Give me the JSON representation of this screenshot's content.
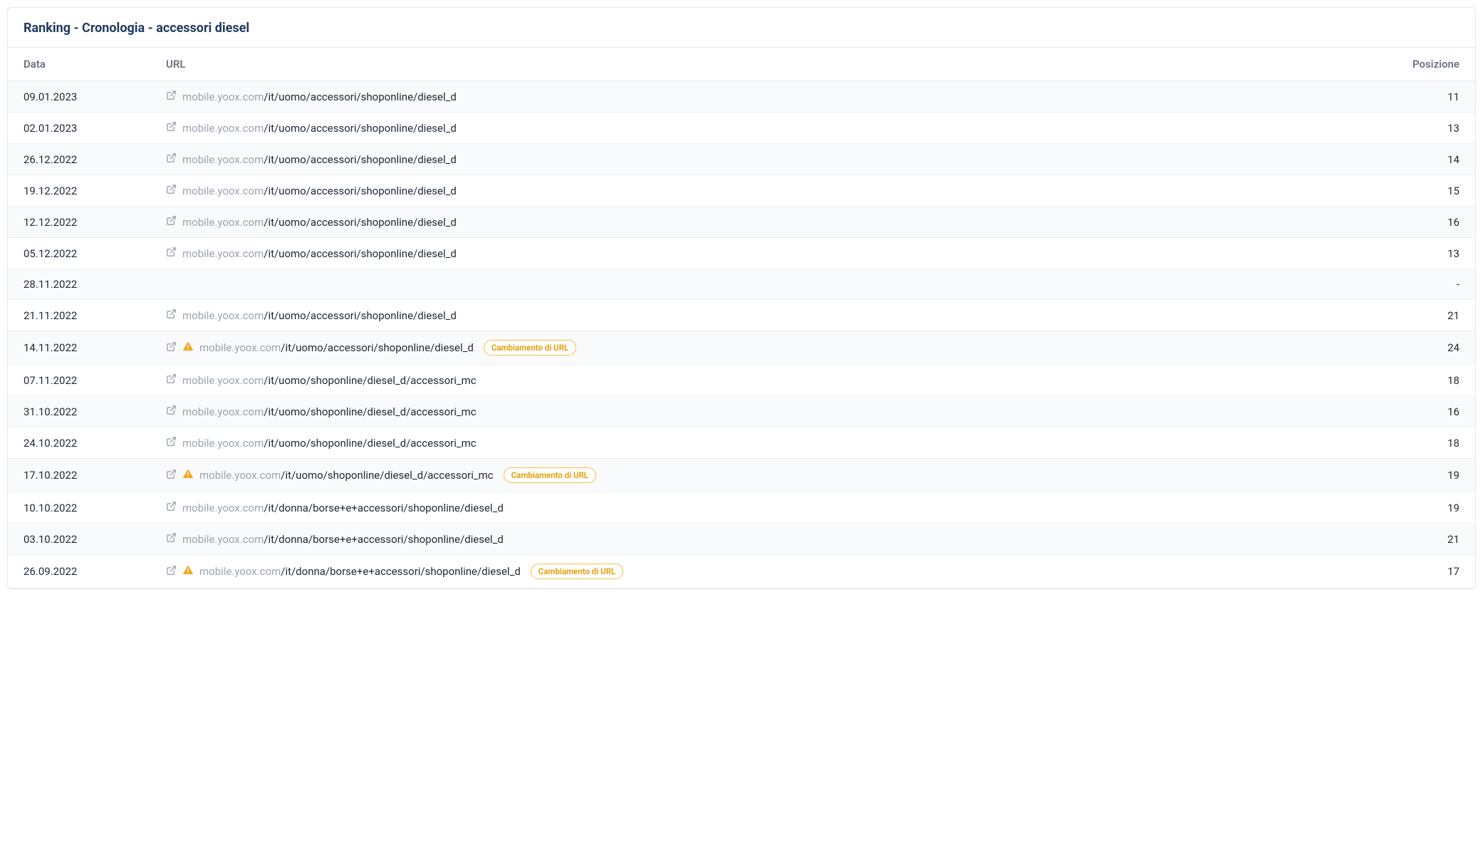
{
  "panel": {
    "title": "Ranking - Cronologia - accessori diesel"
  },
  "table": {
    "headers": {
      "date": "Data",
      "url": "URL",
      "position": "Posizione"
    },
    "badge_label": "Cambiamento di URL",
    "rows": [
      {
        "date": "09.01.2023",
        "domain": "mobile.yoox.com",
        "path": "/it/uomo/accessori/shoponline/diesel_d",
        "url_change": false,
        "position": "11"
      },
      {
        "date": "02.01.2023",
        "domain": "mobile.yoox.com",
        "path": "/it/uomo/accessori/shoponline/diesel_d",
        "url_change": false,
        "position": "13"
      },
      {
        "date": "26.12.2022",
        "domain": "mobile.yoox.com",
        "path": "/it/uomo/accessori/shoponline/diesel_d",
        "url_change": false,
        "position": "14"
      },
      {
        "date": "19.12.2022",
        "domain": "mobile.yoox.com",
        "path": "/it/uomo/accessori/shoponline/diesel_d",
        "url_change": false,
        "position": "15"
      },
      {
        "date": "12.12.2022",
        "domain": "mobile.yoox.com",
        "path": "/it/uomo/accessori/shoponline/diesel_d",
        "url_change": false,
        "position": "16"
      },
      {
        "date": "05.12.2022",
        "domain": "mobile.yoox.com",
        "path": "/it/uomo/accessori/shoponline/diesel_d",
        "url_change": false,
        "position": "13"
      },
      {
        "date": "28.11.2022",
        "domain": "",
        "path": "",
        "url_change": false,
        "position": "-"
      },
      {
        "date": "21.11.2022",
        "domain": "mobile.yoox.com",
        "path": "/it/uomo/accessori/shoponline/diesel_d",
        "url_change": false,
        "position": "21"
      },
      {
        "date": "14.11.2022",
        "domain": "mobile.yoox.com",
        "path": "/it/uomo/accessori/shoponline/diesel_d",
        "url_change": true,
        "position": "24"
      },
      {
        "date": "07.11.2022",
        "domain": "mobile.yoox.com",
        "path": "/it/uomo/shoponline/diesel_d/accessori_mc",
        "url_change": false,
        "position": "18"
      },
      {
        "date": "31.10.2022",
        "domain": "mobile.yoox.com",
        "path": "/it/uomo/shoponline/diesel_d/accessori_mc",
        "url_change": false,
        "position": "16"
      },
      {
        "date": "24.10.2022",
        "domain": "mobile.yoox.com",
        "path": "/it/uomo/shoponline/diesel_d/accessori_mc",
        "url_change": false,
        "position": "18"
      },
      {
        "date": "17.10.2022",
        "domain": "mobile.yoox.com",
        "path": "/it/uomo/shoponline/diesel_d/accessori_mc",
        "url_change": true,
        "position": "19"
      },
      {
        "date": "10.10.2022",
        "domain": "mobile.yoox.com",
        "path": "/it/donna/borse+e+accessori/shoponline/diesel_d",
        "url_change": false,
        "position": "19"
      },
      {
        "date": "03.10.2022",
        "domain": "mobile.yoox.com",
        "path": "/it/donna/borse+e+accessori/shoponline/diesel_d",
        "url_change": false,
        "position": "21"
      },
      {
        "date": "26.09.2022",
        "domain": "mobile.yoox.com",
        "path": "/it/donna/borse+e+accessori/shoponline/diesel_d",
        "url_change": true,
        "position": "17"
      }
    ]
  }
}
